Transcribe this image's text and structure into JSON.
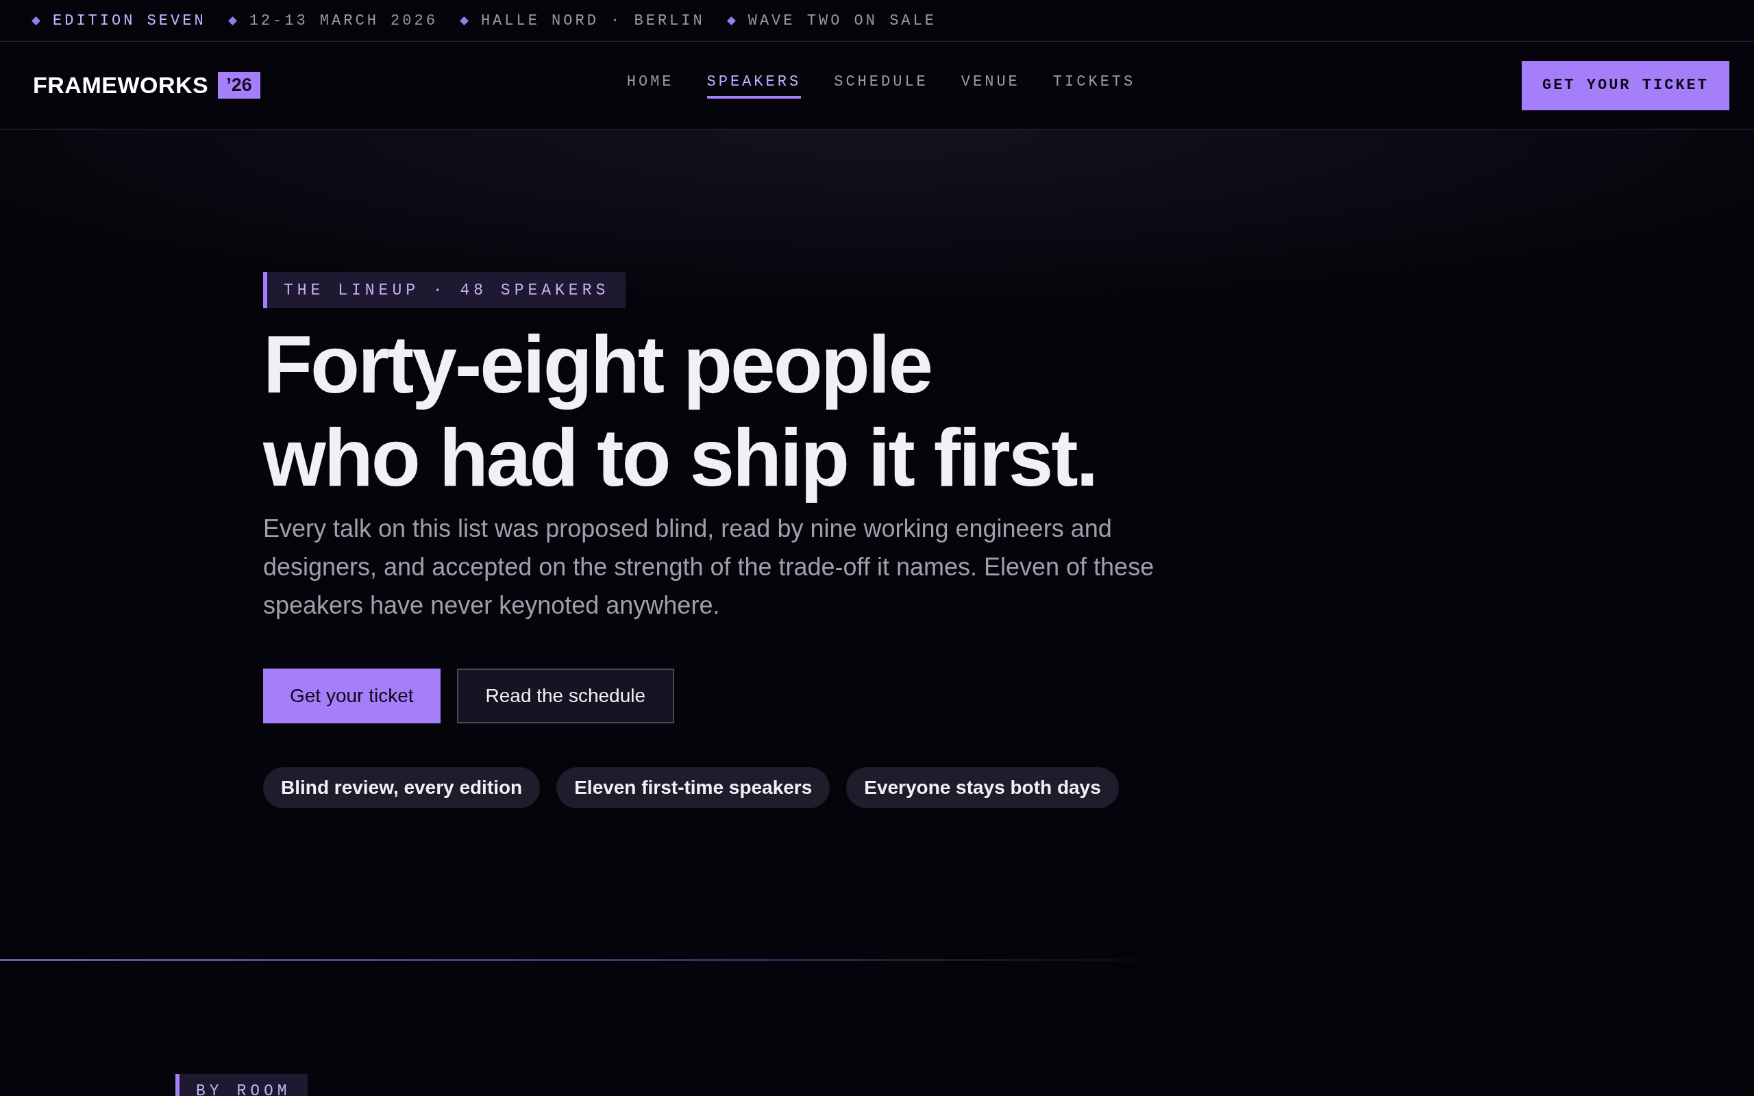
{
  "announcement_bar": [
    {
      "text": "EDITION SEVEN",
      "emphasis": true
    },
    {
      "text": "12-13 MARCH 2026",
      "emphasis": false
    },
    {
      "text": "HALLE NORD · BERLIN",
      "emphasis": false
    },
    {
      "text": "WAVE TWO ON SALE",
      "emphasis": false
    }
  ],
  "nav": {
    "logo": "FRAMEWORKS",
    "logo_badge": "’26",
    "links": [
      {
        "label": "HOME",
        "selected": false
      },
      {
        "label": "SPEAKERS",
        "selected": true
      },
      {
        "label": "SCHEDULE",
        "selected": false
      },
      {
        "label": "VENUE",
        "selected": false
      },
      {
        "label": "TICKETS",
        "selected": false
      }
    ],
    "cta": "GET YOUR TICKET"
  },
  "hero": {
    "eyebrow": "THE LINEUP · 48 SPEAKERS",
    "headline": [
      "Forty-eight people",
      "who had to ship it first."
    ],
    "lead": "Every talk on this list was proposed blind, read by nine working engineers and designers, and accepted on the strength of the trade-off it names. Eleven of these speakers have never keynoted anywhere.",
    "buttons": [
      {
        "label": "Get your ticket",
        "kind": "primary"
      },
      {
        "label": "Read the schedule",
        "kind": "secondary"
      }
    ],
    "chips": [
      "Blind review, every edition",
      "Eleven first-time speakers",
      "Everyone stays both days"
    ]
  },
  "next_section": {
    "eyebrow": "BY ROOM"
  }
}
